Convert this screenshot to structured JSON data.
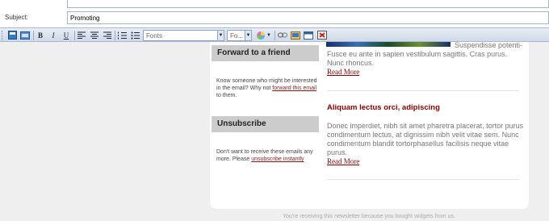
{
  "form": {
    "subject_label": "Subject:",
    "subject_value": "Promoting"
  },
  "toolbar": {
    "font_select": "Fonts",
    "size_select": "Fo..."
  },
  "sidebar": {
    "forward": {
      "heading": "Forward to a friend",
      "text_before": "Know someone who might be interested in the email? Why not ",
      "link": "forward this email",
      "text_after": " to them."
    },
    "unsubscribe": {
      "heading": "Unsubscribe",
      "text_before": "Don't want to receive these emails any more. Please ",
      "link": "unsubscribe instantly"
    }
  },
  "articles": [
    {
      "partial_first_line": "Suspendisse potenti-",
      "body": "Fusce eu ante in sapien vestibulum sagittis. Cras purus. Nunc rhoncus.",
      "read_more": "Read More"
    },
    {
      "title": "Aliquam lectus orci, adipiscing",
      "body": "Donec imperdiet, nibh sit amet pharetra placerat, tortor purus condimentum lectus, at dignissim nibh velit vitae sem. Nunc condimentum blandit tortorphasellus facilisis neque vitae purus.",
      "read_more": "Read More"
    }
  ],
  "footer": {
    "text": "You're receiving this newsletter because you bought widgets from us."
  }
}
